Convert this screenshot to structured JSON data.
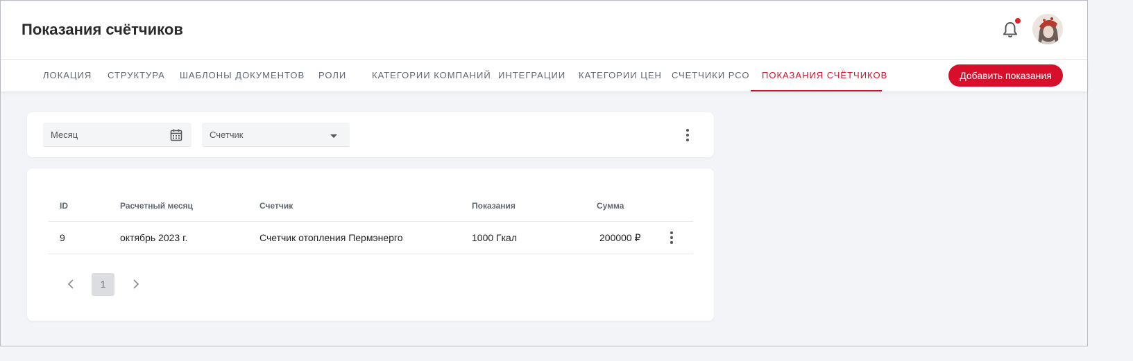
{
  "header": {
    "title": "Показания счётчиков"
  },
  "nav": {
    "tabs": [
      {
        "label": "ЛОКАЦИЯ"
      },
      {
        "label": "СТРУКТУРА"
      },
      {
        "label": "ШАБЛОНЫ ДОКУМЕНТОВ"
      },
      {
        "label": "РОЛИ"
      },
      {
        "label": "КАТЕГОРИИ КОМПАНИЙ"
      },
      {
        "label": "ИНТЕГРАЦИИ"
      },
      {
        "label": "КАТЕГОРИИ ЦЕН"
      },
      {
        "label": "СЧЕТЧИКИ РСО"
      },
      {
        "label": "ПОКАЗАНИЯ СЧЁТЧИКОВ",
        "active": true
      }
    ],
    "add_button_label": "Добавить показания"
  },
  "filters": {
    "month_placeholder": "Месяц",
    "meter_placeholder": "Счетчик"
  },
  "table": {
    "columns": [
      "ID",
      "Расчетный месяц",
      "Счетчик",
      "Показания",
      "Сумма"
    ],
    "rows": [
      {
        "id": "9",
        "month": "октябрь 2023 г.",
        "meter": "Счетчик отопления Пермэнерго",
        "reading": "1000 Гкал",
        "amount": "200000 ₽"
      }
    ]
  },
  "pagination": {
    "current_page": "1"
  },
  "colors": {
    "accent": "#d4102a",
    "background": "#f2f4f8",
    "notification_dot": "#e0202a"
  },
  "icons": {
    "notifications": "bell-icon",
    "calendar": "calendar-icon",
    "dropdown": "caret-down-icon",
    "more": "more-vertical-icon",
    "prev": "chevron-left-icon",
    "next": "chevron-right-icon"
  }
}
